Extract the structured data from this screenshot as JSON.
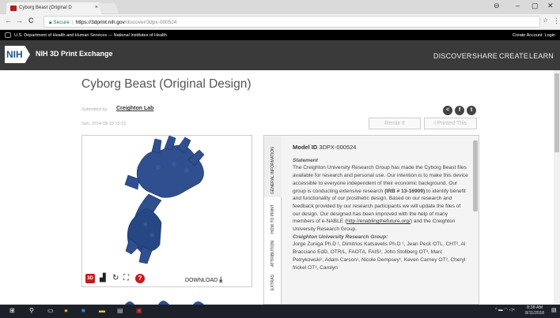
{
  "browser": {
    "tab_title": "Cyborg Beast (Original D",
    "tab_close": "×",
    "secure_label": "Secure",
    "url_host": "https://3dprint.nih.gov",
    "url_path": "/discover/3dpx-000524",
    "win_minimize": "–",
    "win_maximize": "▢",
    "win_close": "✕",
    "back": "←",
    "forward": "→",
    "reload": "C",
    "star": "☆",
    "menu": "⋮"
  },
  "govbar": {
    "text": "U.S. Department of Health and Human Services — National Institutes of Health",
    "create_account": "Create Account",
    "login": "Login"
  },
  "header": {
    "logo_text": "NIH",
    "site_title": "NIH 3D Print Exchange",
    "nav": {
      "discover": "DISCOVER",
      "share": "SHARE",
      "create": "CREATE",
      "learn": "LEARN"
    }
  },
  "main": {
    "title": "Cyborg Beast (Original Design)",
    "submitted_by_label": "Submitted by:",
    "submitter": "Creighton Lab",
    "date": "Sun, 2014-08-10 15:15",
    "remix_label": "Remix It",
    "printed_label": "I Printed This",
    "share_icons": [
      "share-icon",
      "facebook-icon",
      "twitter-icon"
    ]
  },
  "viewer": {
    "download_label": "DOWNLOAD",
    "icon_3d_text": "3D",
    "help_text": "?"
  },
  "tabs": {
    "general": "GENERAL INFORMATION",
    "howto": "HOW TO PRINT",
    "attribution": "ATTRIBUTION",
    "extras": "EXTRAS"
  },
  "info": {
    "model_id_label": "Model ID",
    "model_id": "3DPX-000524",
    "statement_label": "Statement",
    "p1": "The Creighton University Research Group has made the Cyborg Beast files available for research and personal use. Our intention is to make this device accessible to everyone independent of their economic background. Our group is conducting extensive research",
    "irb": "(IRB # 13-16909)",
    "p2": "to identify benefit and functionality of our prosthetic design. Based on our research and feedback provided by our research participants we will update the files of our design. Our designed has been improved with the help of many members of e-NABLE (",
    "link": "http://enablingthefuture.org/",
    "p3": ") and the Creighton University Research Group.",
    "group_label": "Creighton University Research Group:",
    "authors": "Jorge Zuniga Ph.D ¹, Dimitrios Katsavelis Ph.D ¹, Jean Peck OTL, CHT², Al Bracciano EdD, OTR/L, FAOTA, FAIS², John Stollberg OT³, Marc Petrykowski¹, Adam Carson¹, Nicole Dempsey¹, Keven Carney OT³, Cheryl frickel OT³, Carolyn"
  },
  "taskbar": {
    "time": "8:38 AM",
    "date": "8/11/2018"
  },
  "colors": {
    "accent": "#c7191e",
    "header_bg": "#3a3a3a",
    "hand_blue": "#2f4f8f"
  }
}
